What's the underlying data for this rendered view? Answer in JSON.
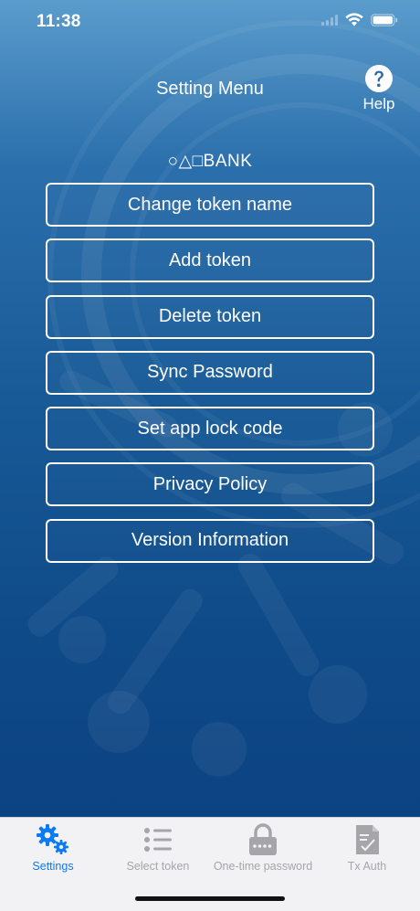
{
  "status_bar": {
    "time": "11:38",
    "icons": [
      "signal-icon",
      "wifi-icon",
      "battery-icon"
    ]
  },
  "header": {
    "title": "Setting Menu",
    "help_label": "Help",
    "help_icon": "question-circle-icon"
  },
  "bank_name": "○△□BANK",
  "menu": {
    "items": [
      {
        "label": "Change token name"
      },
      {
        "label": "Add token"
      },
      {
        "label": "Delete token"
      },
      {
        "label": "Sync Password"
      },
      {
        "label": "Set app lock code"
      },
      {
        "label": "Privacy Policy"
      },
      {
        "label": "Version Information"
      }
    ]
  },
  "tab_bar": {
    "tabs": [
      {
        "label": "Settings",
        "icon": "gears-icon",
        "active": true
      },
      {
        "label": "Select token",
        "icon": "list-icon",
        "active": false
      },
      {
        "label": "One-time password",
        "icon": "padlock-password-icon",
        "active": false
      },
      {
        "label": "Tx Auth",
        "icon": "document-check-icon",
        "active": false
      }
    ]
  },
  "colors": {
    "accent": "#0a7af5",
    "inactive": "#a5a5aa",
    "background_top": "#5a9ccc",
    "background_bottom": "#0b3f7e",
    "button_border": "#ffffff"
  }
}
